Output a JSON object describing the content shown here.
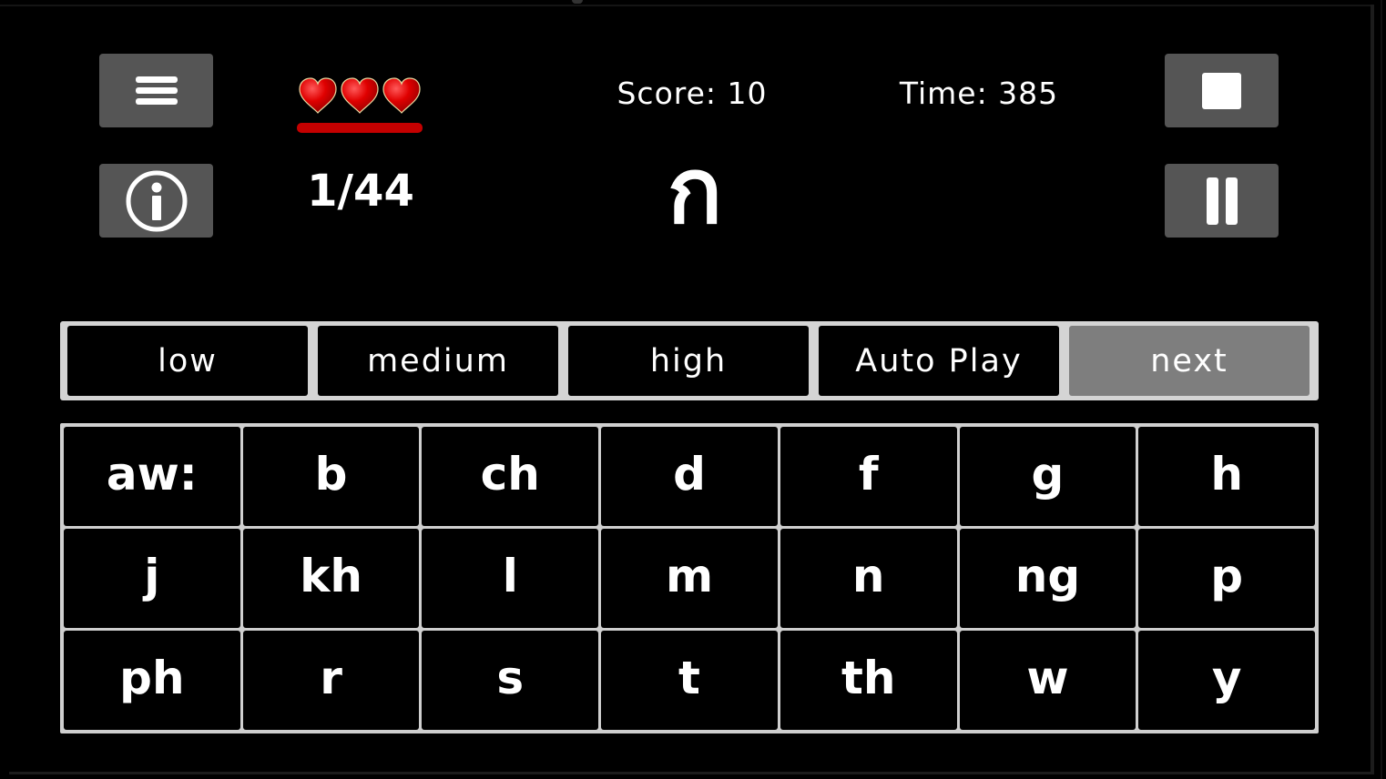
{
  "header": {
    "score_text": "Score: 10",
    "time_text": "Time: 385",
    "progress_text": "1/44",
    "lives": 3,
    "life_fraction": 1.0,
    "current_character": "ก"
  },
  "buttons": {
    "menu_icon": "hamburger-menu-icon",
    "info_icon": "info-circle-icon",
    "stop_icon": "stop-square-icon",
    "pause_icon": "pause-icon"
  },
  "colors": {
    "button_bg": "#555555",
    "heart": "#cc0000",
    "life_bar": "#c40000",
    "active_mode": "#7e7e7e",
    "panel_border": "#d4d4d4"
  },
  "modes": [
    {
      "label": "low",
      "active": false
    },
    {
      "label": "medium",
      "active": false
    },
    {
      "label": "high",
      "active": false
    },
    {
      "label": "Auto Play",
      "active": false
    },
    {
      "label": "next",
      "active": true
    }
  ],
  "keys": [
    "aw:",
    "b",
    "ch",
    "d",
    "f",
    "g",
    "h",
    "j",
    "kh",
    "l",
    "m",
    "n",
    "ng",
    "p",
    "ph",
    "r",
    "s",
    "t",
    "th",
    "w",
    "y"
  ]
}
